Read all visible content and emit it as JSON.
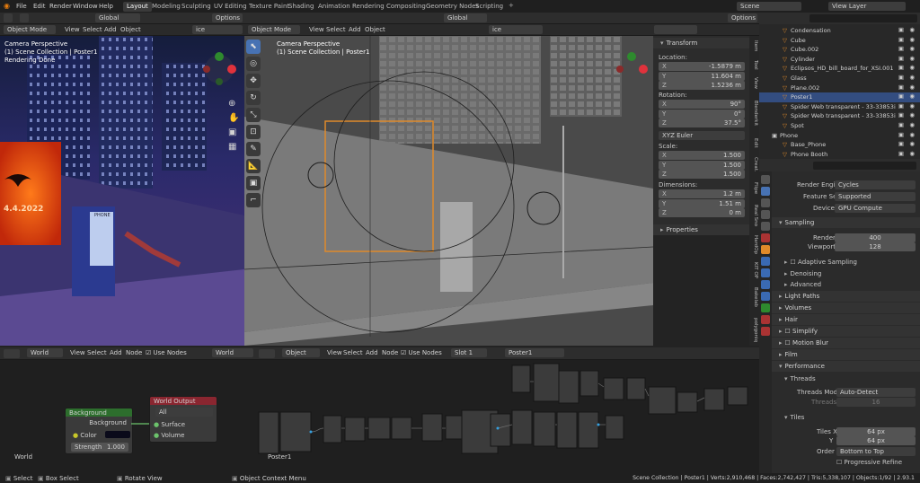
{
  "app": {
    "menus": [
      "File",
      "Edit",
      "Render",
      "Window",
      "Help"
    ],
    "workspaces": [
      "Layout",
      "Modeling",
      "Sculpting",
      "UV Editing",
      "Texture Paint",
      "Shading",
      "Animation",
      "Rendering",
      "Compositing",
      "Geometry Nodes",
      "Scripting"
    ],
    "active_workspace": "Layout",
    "scene": "Scene",
    "view_layer": "View Layer",
    "add_icon": "+"
  },
  "left_view": {
    "mode": "Object Mode",
    "menus": [
      "View",
      "Select",
      "Add",
      "Object"
    ],
    "transform": "Global",
    "search": "ice",
    "overlay_title": "Camera Perspective",
    "overlay_sub": "(1) Scene Collection | Poster1",
    "overlay_status": "Rendering Done",
    "options": "Options",
    "poster_text": "4.4.2022",
    "booth_text": "PHONE"
  },
  "main_view": {
    "mode": "Object Mode",
    "menus": [
      "View",
      "Select",
      "Add",
      "Object"
    ],
    "transform": "Global",
    "search": "ice",
    "overlay_title": "Camera Perspective",
    "overlay_sub": "(1) Scene Collection | Poster1",
    "options": "Options"
  },
  "transform": {
    "title": "Transform",
    "location_label": "Location:",
    "rotation_label": "Rotation:",
    "scale_label": "Scale:",
    "dimensions_label": "Dimensions:",
    "loc": [
      [
        "X",
        "-1.5879 m"
      ],
      [
        "Y",
        "11.604 m"
      ],
      [
        "Z",
        "1.5236 m"
      ]
    ],
    "rot": [
      [
        "X",
        "90°"
      ],
      [
        "Y",
        "0°"
      ],
      [
        "Z",
        "37.5°"
      ]
    ],
    "rot_mode": "XYZ Euler",
    "scale": [
      [
        "X",
        "1.500"
      ],
      [
        "Y",
        "1.500"
      ],
      [
        "Z",
        "1.500"
      ]
    ],
    "dims": [
      [
        "X",
        "1.2 m"
      ],
      [
        "Y",
        "1.51 m"
      ],
      [
        "Z",
        "0 m"
      ]
    ],
    "properties": "Properties"
  },
  "side_tabs": [
    "Item",
    "Tool",
    "View",
    "Blenderkit",
    "Edit",
    "Creat.",
    "Flipe",
    "Real Sno",
    "HardOp",
    "KIT OP",
    "Bakelab",
    "polygoniq"
  ],
  "outliner": {
    "items": [
      "Condensation",
      "Cube",
      "Cube.002",
      "Cylinder",
      "Eclipsos_HD_bill_board_for_XSI.001",
      "Glass",
      "Plane.002",
      "Poster1",
      "Spider Web transparent - 33-33853i",
      "Spider Web transparent - 33-33853i",
      "Spot",
      "Phone",
      "Base_Phone",
      "Phone Booth"
    ],
    "selected": "Poster1"
  },
  "render_props": {
    "render_engine_label": "Render Engine",
    "render_engine": "Cycles",
    "feature_set_label": "Feature Set",
    "feature_set": "Supported",
    "device_label": "Device",
    "device": "GPU Compute",
    "sampling": "Sampling",
    "render_label": "Render",
    "render_val": "400",
    "viewport_label": "Viewport",
    "viewport_val": "128",
    "adaptive": "Adaptive Sampling",
    "denoising": "Denoising",
    "advanced": "Advanced",
    "light_paths": "Light Paths",
    "volumes": "Volumes",
    "hair": "Hair",
    "simplify": "Simplify",
    "motion_blur": "Motion Blur",
    "film": "Film",
    "performance": "Performance",
    "threads": "Threads",
    "threads_mode_label": "Threads Mode",
    "threads_mode": "Auto-Detect",
    "threads_label": "Threads",
    "threads_val": "16",
    "tiles": "Tiles",
    "tiles_x_label": "Tiles X",
    "tiles_x": "64 px",
    "tiles_y_label": "Y",
    "tiles_y": "64 px",
    "order_label": "Order",
    "order": "Bottom to Top",
    "progressive": "Progressive Refine"
  },
  "world_editor": {
    "type": "World",
    "menus": [
      "View",
      "Select",
      "Add",
      "Node"
    ],
    "use_nodes": "Use Nodes",
    "world_name": "World",
    "footer": "World",
    "bg_node": {
      "title": "Background",
      "out": "Background",
      "color": "Color",
      "strength_label": "Strength",
      "strength": "1.000"
    },
    "out_node": {
      "title": "World Output",
      "target": "All",
      "surface": "Surface",
      "volume": "Volume"
    }
  },
  "shader_editor": {
    "type": "Object",
    "menus": [
      "View",
      "Select",
      "Add",
      "Node"
    ],
    "use_nodes": "Use Nodes",
    "slot": "Slot 1",
    "material": "Poster1",
    "footer": "Poster1"
  },
  "statusbar": {
    "select": "Select",
    "box_select": "Box Select",
    "rotate": "Rotate View",
    "context": "Object Context Menu",
    "stats": "Scene Collection | Poster1 | Verts:2,910,468 | Faces:2,742,427 | Tris:5,338,107 | Objects:1/92 | 2.93.1"
  }
}
